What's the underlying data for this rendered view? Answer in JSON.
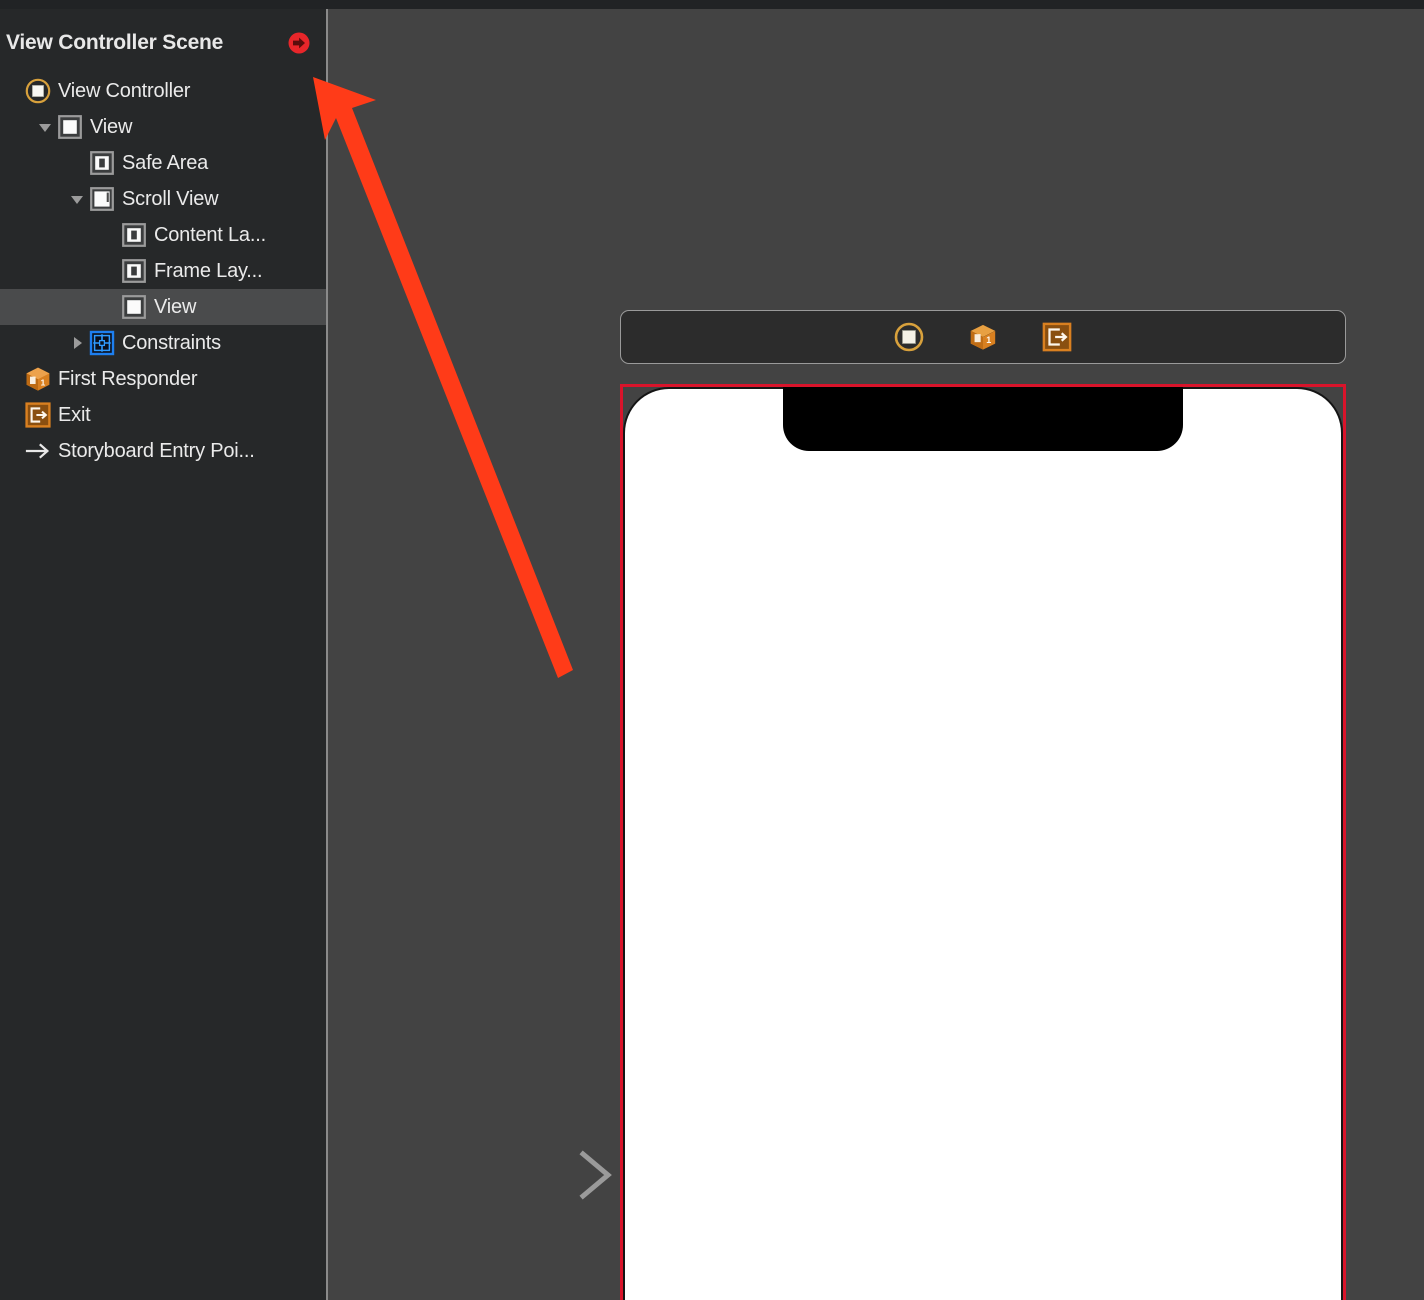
{
  "app": {
    "panel_title": "View Controller Scene"
  },
  "sidebar": {
    "header": {
      "title": "View Controller Scene",
      "badge_icon": "storyboard-entry-point-badge-icon",
      "badge_color": "#e8262a"
    },
    "rows": [
      {
        "label": "View Controller",
        "icon": "view-controller-icon",
        "depth": 0,
        "disclosure": "none",
        "selected": false
      },
      {
        "label": "View",
        "icon": "view-icon",
        "depth": 1,
        "disclosure": "expanded",
        "selected": false
      },
      {
        "label": "Safe Area",
        "icon": "layout-guide-icon",
        "depth": 2,
        "disclosure": "none",
        "selected": false
      },
      {
        "label": "Scroll View",
        "icon": "scroll-view-icon",
        "depth": 2,
        "disclosure": "expanded",
        "selected": false
      },
      {
        "label": "Content La...",
        "icon": "layout-guide-icon",
        "depth": 3,
        "disclosure": "none",
        "selected": false
      },
      {
        "label": "Frame Lay...",
        "icon": "layout-guide-icon",
        "depth": 3,
        "disclosure": "none",
        "selected": false
      },
      {
        "label": "View",
        "icon": "view-icon",
        "depth": 3,
        "disclosure": "none",
        "selected": true
      },
      {
        "label": "Constraints",
        "icon": "constraints-icon",
        "depth": 2,
        "disclosure": "collapsed",
        "selected": false
      },
      {
        "label": "First Responder",
        "icon": "first-responder-icon",
        "depth": 0,
        "disclosure": "none",
        "selected": false
      },
      {
        "label": "Exit",
        "icon": "exit-icon",
        "depth": 0,
        "disclosure": "none",
        "selected": false
      },
      {
        "label": "Storyboard Entry Poi...",
        "icon": "entry-point-arrow-icon",
        "depth": 0,
        "disclosure": "none",
        "selected": false
      }
    ]
  },
  "canvas": {
    "scene_dock": {
      "items": [
        {
          "name": "view-controller-dock-icon",
          "label": "View Controller"
        },
        {
          "name": "first-responder-dock-icon",
          "label": "First Responder"
        },
        {
          "name": "exit-dock-icon",
          "label": "Exit"
        }
      ]
    },
    "device": {
      "selected": true,
      "selection_color": "#d9142b",
      "screen_color": "#ffffff",
      "has_notch": true
    },
    "entry_point_arrow": {
      "name": "storyboard-entry-point-arrow",
      "color": "#8e8e8e"
    }
  },
  "annotation": {
    "arrow": {
      "name": "red-annotation-arrow",
      "color": "#ff3b18",
      "points_to": "View Controller Scene"
    }
  },
  "colors": {
    "sidebar_bg": "#262829",
    "canvas_bg": "#434343",
    "selection_row": "#4a4b4c",
    "accent_orange": "#e8962a",
    "accent_blue": "#1d7ff0",
    "accent_red": "#d9142b"
  }
}
